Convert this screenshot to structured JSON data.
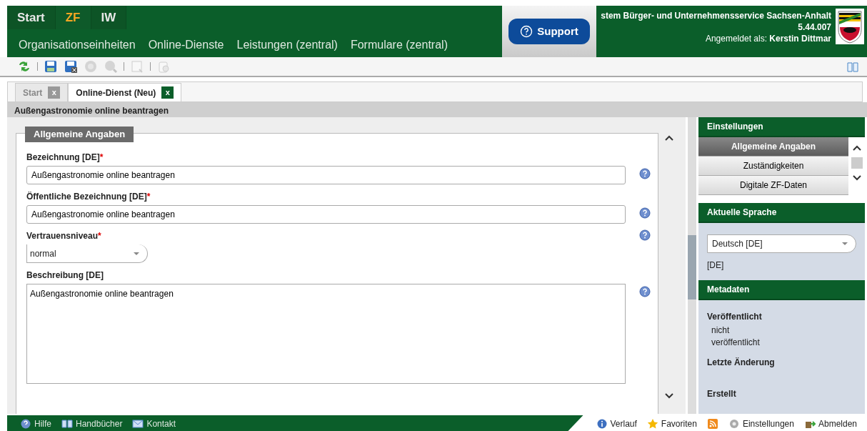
{
  "top_tabs": [
    {
      "label": "Start",
      "selected": false
    },
    {
      "label": "ZF",
      "selected": true
    },
    {
      "label": "IW",
      "selected": false
    }
  ],
  "menu": [
    "Organisationseinheiten",
    "Online-Dienste",
    "Leistungen (zentral)",
    "Formulare (zentral)"
  ],
  "support": {
    "label": "Support"
  },
  "app_info": {
    "title": "stem Bürger- und Unternehmensservice Sachsen-Anhalt",
    "version": "5.44.007",
    "login_label": "Angemeldet als:",
    "user": "Kerstin Dittmar"
  },
  "toolbar": [
    {
      "kind": "refresh",
      "disabled": false
    },
    {
      "kind": "separator"
    },
    {
      "kind": "save",
      "disabled": false
    },
    {
      "kind": "save-close",
      "disabled": false
    },
    {
      "kind": "globe",
      "disabled": true
    },
    {
      "kind": "globe-search",
      "disabled": true
    },
    {
      "kind": "separator"
    },
    {
      "kind": "preview",
      "disabled": true
    },
    {
      "kind": "separator"
    },
    {
      "kind": "clipboard",
      "disabled": true
    }
  ],
  "doc_tabs": [
    {
      "label": "Start",
      "selected": false,
      "close": "x"
    },
    {
      "label": "Online-Dienst (Neu)",
      "selected": true,
      "close": "x"
    }
  ],
  "page_title": "Außengastronomie online beantragen",
  "form": {
    "legend": "Allgemeine Angaben",
    "fields": [
      {
        "kind": "text",
        "label": "Bezeichnung [DE]",
        "required_mark": "*",
        "value": "Außengastronomie online beantragen"
      },
      {
        "kind": "text",
        "label": "Öffentliche Bezeichnung [DE]",
        "required_mark": "*",
        "value": "Außengastronomie online beantragen"
      },
      {
        "kind": "select",
        "label": "Vertrauensniveau",
        "required_mark": "*",
        "value": "normal"
      },
      {
        "kind": "textarea",
        "label": "Beschreibung [DE]",
        "value": "Außengastronomie online beantragen"
      }
    ]
  },
  "sidebar": {
    "settings": {
      "title": "Einstellungen",
      "items": [
        {
          "label": "Allgemeine Angaben",
          "selected": true
        },
        {
          "label": "Zuständigkeiten",
          "selected": false
        },
        {
          "label": "Digitale ZF-Daten",
          "selected": false
        }
      ]
    },
    "language": {
      "title": "Aktuelle Sprache",
      "value": "Deutsch [DE]",
      "code": "[DE]"
    },
    "metadata": {
      "title": "Metadaten",
      "items": [
        {
          "label": "Veröffentlicht",
          "value": "nicht veröffentlicht"
        },
        {
          "label": "Letzte Änderung"
        },
        {
          "label": "Erstellt"
        }
      ]
    }
  },
  "footer": {
    "left": [
      {
        "kind": "help",
        "label": "Hilfe"
      },
      {
        "kind": "book",
        "label": "Handbücher"
      },
      {
        "kind": "mail",
        "label": "Kontakt"
      }
    ],
    "right": [
      {
        "kind": "info",
        "label": "Verlauf"
      },
      {
        "kind": "star",
        "label": "Favoriten"
      },
      {
        "kind": "rss"
      },
      {
        "kind": "gear",
        "label": "Einstellungen"
      },
      {
        "kind": "logout",
        "label": "Abmelden"
      }
    ]
  }
}
